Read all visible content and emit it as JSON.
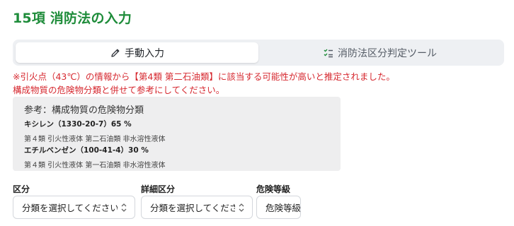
{
  "page": {
    "title": "15項 消防法の入力"
  },
  "tabs": [
    {
      "label": "手動入力",
      "icon": "pencil-icon",
      "active": true
    },
    {
      "label": "消防法区分判定ツール",
      "icon": "checklist-icon",
      "active": false
    }
  ],
  "warning": {
    "line1": "※引火点（43℃）の情報から【第4類 第二石油類】に該当する可能性が高いと推定されました。",
    "line2": "構成物質の危険物分類と併せて参考にしてください。"
  },
  "reference": {
    "title": "参考：構成物質の危険物分類",
    "substances": [
      {
        "name": "キシレン（1330-20-7）65 %",
        "classification": "第４類 引火性液体 第二石油類 非水溶性液体"
      },
      {
        "name": "エチルベンゼン（100-41-4）30 %",
        "classification": "第４類 引火性液体 第一石油類 非水溶性液体"
      }
    ]
  },
  "form": {
    "category": {
      "label": "区分",
      "placeholder": "分類を選択してください"
    },
    "detail_category": {
      "label": "詳細区分",
      "placeholder": "分類を選択してください"
    },
    "hazard_level": {
      "label": "危険等級",
      "placeholder": "危険等級"
    }
  },
  "colors": {
    "accent": "#1e8c3a",
    "warning": "#d6282f"
  }
}
